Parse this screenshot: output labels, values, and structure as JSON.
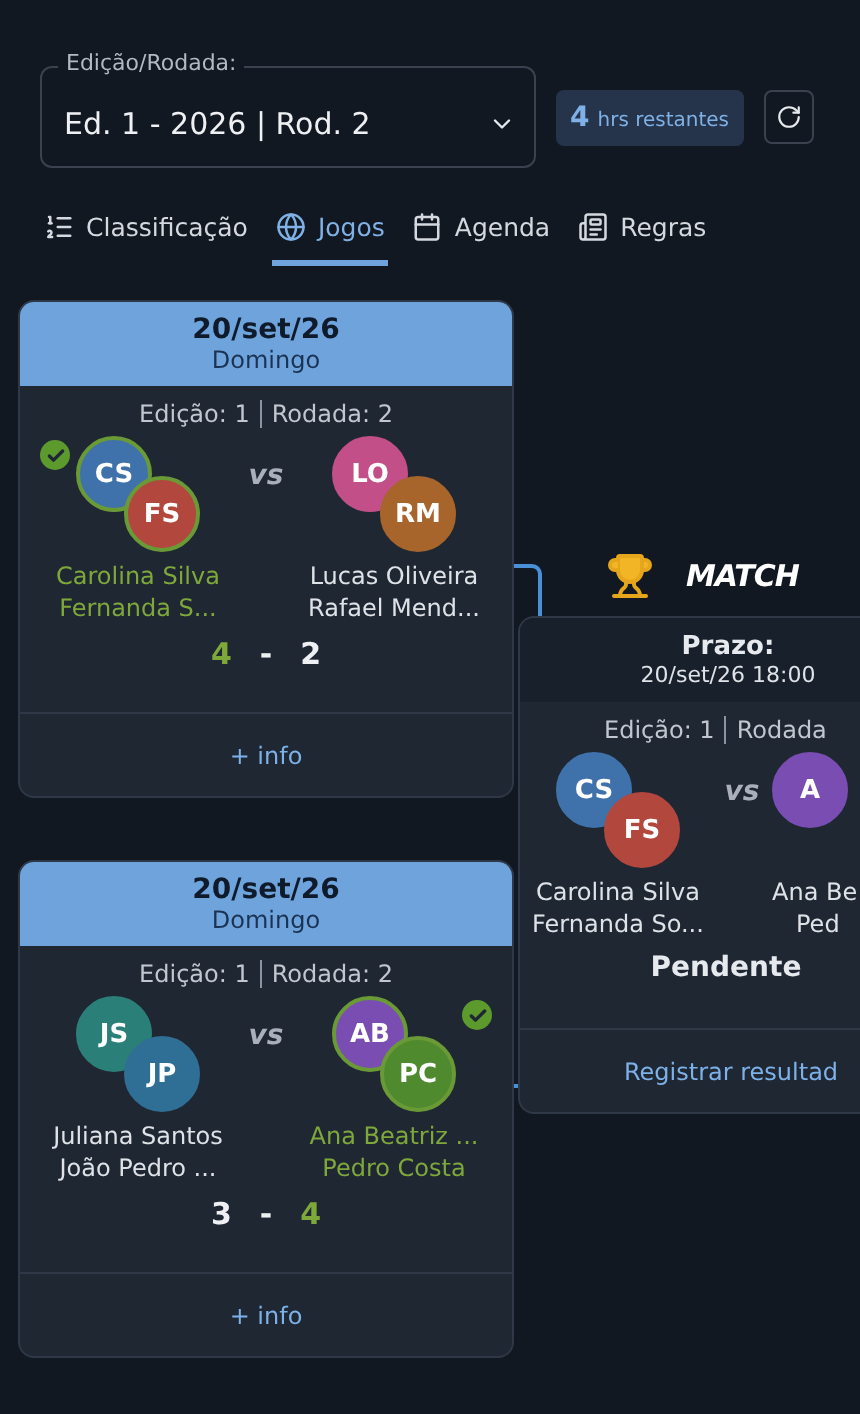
{
  "round_select": {
    "label": "Edição/Rodada:",
    "value": "Ed. 1 - 2026 | Rod. 2"
  },
  "time_left": {
    "count": "4",
    "unit": "hrs restantes"
  },
  "tabs": [
    {
      "kind": "list",
      "label": "Classificação",
      "selected": false
    },
    {
      "kind": "ball",
      "label": "Jogos",
      "selected": true
    },
    {
      "kind": "calendar",
      "label": "Agenda",
      "selected": false
    },
    {
      "kind": "rules",
      "label": "Regras",
      "selected": false
    }
  ],
  "matches": [
    {
      "date": "20/set/26",
      "weekday": "Domingo",
      "edition": "Edição: 1",
      "round": "Rodada: 2",
      "teams": [
        {
          "winner": true,
          "avatars": [
            {
              "initials": "CS",
              "color": "#3f72aa"
            },
            {
              "initials": "FS",
              "color": "#b2473e"
            }
          ],
          "names": [
            "Carolina Silva",
            "Fernanda S..."
          ]
        },
        {
          "winner": false,
          "avatars": [
            {
              "initials": "LO",
              "color": "#c24f88"
            },
            {
              "initials": "RM",
              "color": "#a7652b"
            }
          ],
          "names": [
            "Lucas Oliveira",
            "Rafael Mend..."
          ]
        }
      ],
      "versus": "vs",
      "score": [
        "4",
        "2"
      ],
      "score_separator": "-",
      "info": "+ info"
    },
    {
      "date": "20/set/26",
      "weekday": "Domingo",
      "edition": "Edição: 1",
      "round": "Rodada: 2",
      "teams": [
        {
          "winner": false,
          "avatars": [
            {
              "initials": "JS",
              "color": "#2a8078"
            },
            {
              "initials": "JP",
              "color": "#2f6f96"
            }
          ],
          "names": [
            "Juliana Santos",
            "João Pedro ..."
          ]
        },
        {
          "winner": true,
          "avatars": [
            {
              "initials": "AB",
              "color": "#7a4db2"
            },
            {
              "initials": "PC",
              "color": "#4f8a2f"
            }
          ],
          "names": [
            "Ana Beatriz ...",
            "Pedro Costa"
          ]
        }
      ],
      "versus": "vs",
      "score": [
        "3",
        "4"
      ],
      "score_separator": "-",
      "info": "+ info"
    }
  ],
  "final": {
    "logo": "MATCH",
    "deadline_label": "Prazo:",
    "deadline": "20/set/26 18:00",
    "edition": "Edição: 1",
    "round": "Rodada",
    "teams": [
      {
        "avatars": [
          {
            "initials": "CS",
            "color": "#3f72aa"
          },
          {
            "initials": "FS",
            "color": "#b2473e"
          }
        ],
        "names": [
          "Carolina Silva",
          "Fernanda So..."
        ]
      },
      {
        "avatars": [
          {
            "initials": "A",
            "color": "#7a4db2"
          }
        ],
        "names": [
          "Ana Be",
          "Ped"
        ]
      }
    ],
    "versus": "vs",
    "status": "Pendente",
    "action": "Registrar resultad"
  }
}
